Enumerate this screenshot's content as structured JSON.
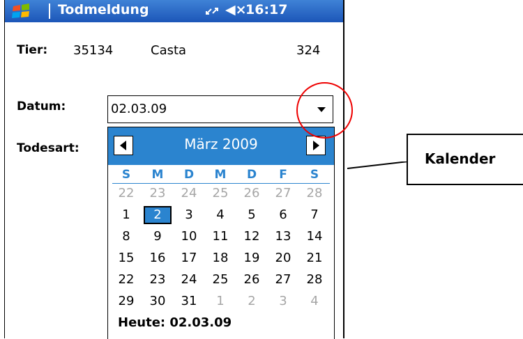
{
  "statusbar": {
    "title": "Todmeldung",
    "time": "16:17",
    "volume_icon": "◀×"
  },
  "animal": {
    "label": "Tier:",
    "id": "35134",
    "name": "Casta",
    "number": "324"
  },
  "date": {
    "label": "Datum:",
    "value": "02.03.09"
  },
  "death_type": {
    "label": "Todesart:"
  },
  "calendar": {
    "month_title": "März 2009",
    "weekdays": [
      "S",
      "M",
      "D",
      "M",
      "D",
      "F",
      "S"
    ],
    "weeks": [
      [
        {
          "d": "22",
          "dim": true
        },
        {
          "d": "23",
          "dim": true
        },
        {
          "d": "24",
          "dim": true
        },
        {
          "d": "25",
          "dim": true
        },
        {
          "d": "26",
          "dim": true
        },
        {
          "d": "27",
          "dim": true
        },
        {
          "d": "28",
          "dim": true
        }
      ],
      [
        {
          "d": "1"
        },
        {
          "d": "2",
          "selected": true
        },
        {
          "d": "3"
        },
        {
          "d": "4"
        },
        {
          "d": "5"
        },
        {
          "d": "6"
        },
        {
          "d": "7"
        }
      ],
      [
        {
          "d": "8"
        },
        {
          "d": "9"
        },
        {
          "d": "10"
        },
        {
          "d": "11"
        },
        {
          "d": "12"
        },
        {
          "d": "13"
        },
        {
          "d": "14"
        }
      ],
      [
        {
          "d": "15"
        },
        {
          "d": "16"
        },
        {
          "d": "17"
        },
        {
          "d": "18"
        },
        {
          "d": "19"
        },
        {
          "d": "20"
        },
        {
          "d": "21"
        }
      ],
      [
        {
          "d": "22"
        },
        {
          "d": "23"
        },
        {
          "d": "24"
        },
        {
          "d": "25"
        },
        {
          "d": "26"
        },
        {
          "d": "27"
        },
        {
          "d": "28"
        }
      ],
      [
        {
          "d": "29"
        },
        {
          "d": "30"
        },
        {
          "d": "31"
        },
        {
          "d": "1",
          "dim": true
        },
        {
          "d": "2",
          "dim": true
        },
        {
          "d": "3",
          "dim": true
        },
        {
          "d": "4",
          "dim": true
        }
      ]
    ],
    "today_label": "Heute: 02.03.09"
  },
  "callout": {
    "text": "Kalender"
  },
  "colors": {
    "accent": "#2b84cf",
    "annotation": "#e00000"
  }
}
